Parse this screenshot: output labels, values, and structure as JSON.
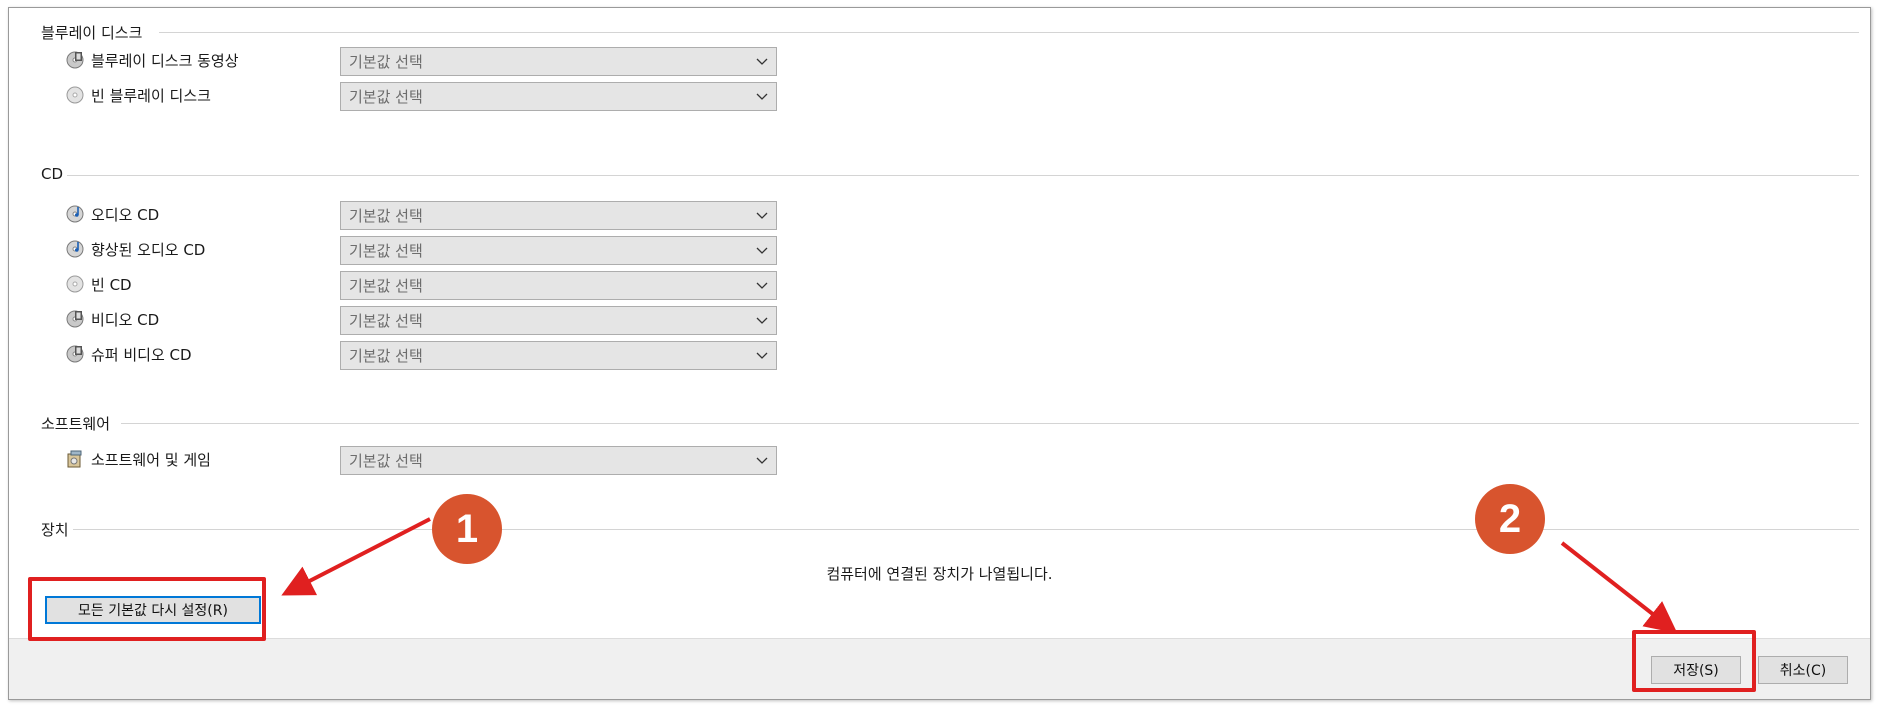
{
  "sections": {
    "bluray": {
      "title": "블루레이 디스크",
      "items": [
        {
          "label": "블루레이 디스크 동영상",
          "icon": "video-disc-icon",
          "value": "기본값 선택"
        },
        {
          "label": "빈 블루레이 디스크",
          "icon": "blank-disc-icon",
          "value": "기본값 선택"
        }
      ]
    },
    "cd": {
      "title": "CD",
      "items": [
        {
          "label": "오디오 CD",
          "icon": "audio-disc-icon",
          "value": "기본값 선택"
        },
        {
          "label": "향상된 오디오 CD",
          "icon": "audio-disc-icon",
          "value": "기본값 선택"
        },
        {
          "label": "빈 CD",
          "icon": "blank-disc-icon",
          "value": "기본값 선택"
        },
        {
          "label": "비디오 CD",
          "icon": "video-disc-icon",
          "value": "기본값 선택"
        },
        {
          "label": "슈퍼 비디오 CD",
          "icon": "video-disc-icon",
          "value": "기본값 선택"
        }
      ]
    },
    "software": {
      "title": "소프트웨어",
      "items": [
        {
          "label": "소프트웨어 및 게임",
          "icon": "software-box-icon",
          "value": "기본값 선택"
        }
      ]
    },
    "devices": {
      "title": "장치",
      "empty_text": "컴퓨터에 연결된 장치가 나열됩니다."
    }
  },
  "buttons": {
    "reset_all": "모든 기본값 다시 설정(R)",
    "save": "저장(S)",
    "cancel": "취소(C)"
  },
  "annotations": {
    "badge1": "1",
    "badge2": "2",
    "highlight_color": "#e02020",
    "badge_color": "#d8542e"
  }
}
